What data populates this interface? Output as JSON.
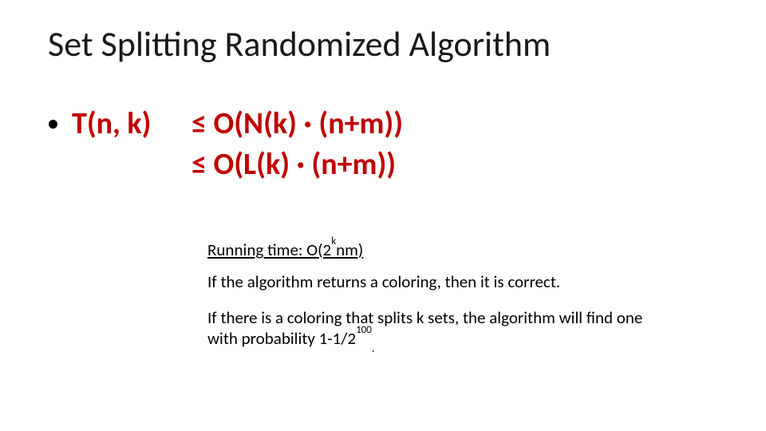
{
  "title": "Set Splitting Randomized Algorithm",
  "formula": {
    "lhs": "T(n, k)",
    "rhs1_a": "≤ O(N(k)",
    "rhs1_b": "(n+m))",
    "rhs2_a": "≤ O(L(k)",
    "rhs2_b": "(n+m))",
    "dot": "·"
  },
  "running_time": {
    "prefix": "Running time: O(2",
    "sup": "k",
    "suffix": "nm)"
  },
  "para_correct": "If the algorithm returns a coloring, then it is correct.",
  "para_prob": {
    "a": "If there is a coloring that splits k sets, the algorithm will find one with probability 1-1/2",
    "sup": "100",
    "b": "."
  }
}
